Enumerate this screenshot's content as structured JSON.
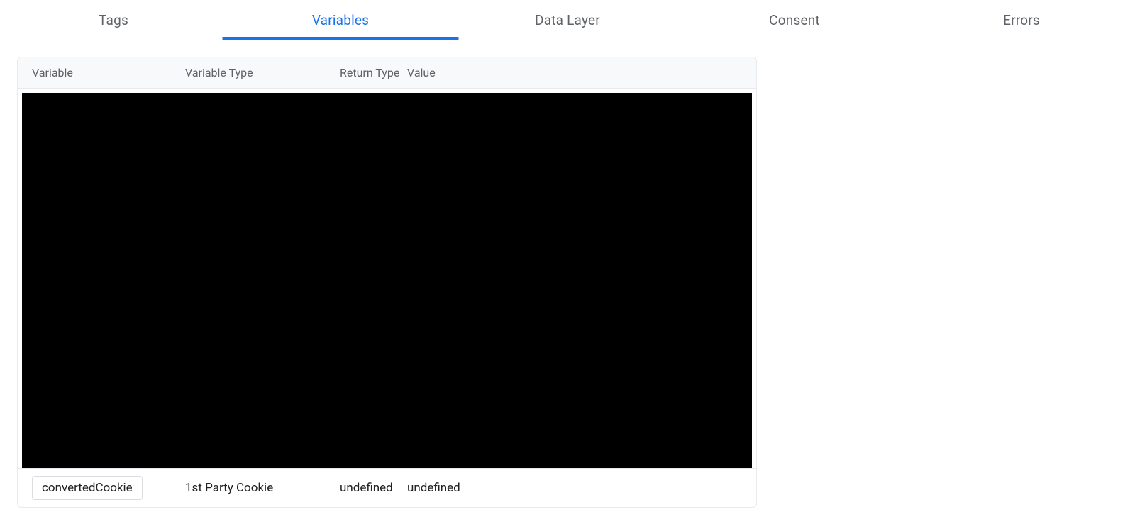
{
  "tabs": {
    "tags": "Tags",
    "variables": "Variables",
    "datalayer": "Data Layer",
    "consent": "Consent",
    "errors": "Errors"
  },
  "columns": {
    "variable": "Variable",
    "variable_type": "Variable Type",
    "return_type": "Return Type",
    "value": "Value"
  },
  "rows": [
    {
      "variable": "convertedCookie",
      "variable_type": "1st Party Cookie",
      "return_type": "undefined",
      "value": "undefined"
    }
  ]
}
